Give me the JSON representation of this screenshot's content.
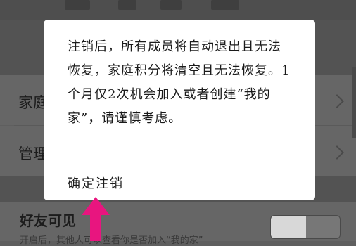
{
  "background_rows": [
    {
      "label": "家庭"
    },
    {
      "label": "管理"
    }
  ],
  "friend_visible": {
    "label": "好友可见",
    "sublabel": "开启后，其他人可以查看你是否加入“我的家”",
    "toggle_on": false
  },
  "dialog": {
    "message": "注销后，所有成员将自动退出且无法恢复，家庭积分将清空且无法恢复。1个月仅2次机会加入或者创建“我的家”，请谨慎考虑。",
    "confirm_label": "确定注销"
  },
  "annotation": {
    "arrow_color": "#e8157f"
  }
}
